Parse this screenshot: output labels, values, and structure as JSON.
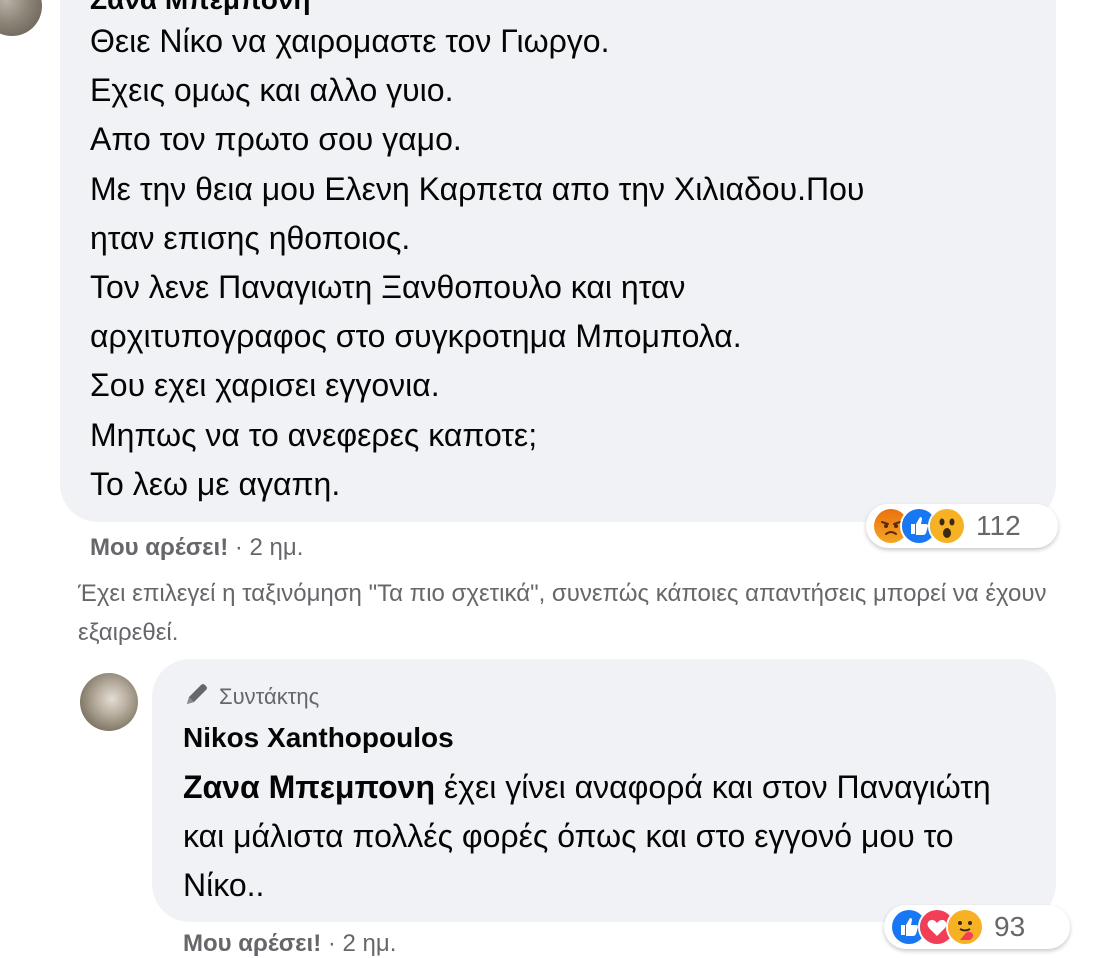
{
  "top_comment": {
    "author": "Ζανα Μπεμπονη",
    "lines": [
      "Θειε Νίκο να χαιρομαστε τον Γιωργο.",
      "Εχεις ομως και αλλο γυιο.",
      "Απο τον πρωτο σου γαμο.",
      "Με την θεια μου Ελενη Καρπετα απο την Χιλιαδου.Που",
      "ηταν επισης ηθοποιος.",
      "Τον λενε Παναγιωτη Ξανθοπουλο και ηταν",
      "αρχιτυπογραφος στο συγκροτημα Μπομπολα.",
      "Σου εχει χαρισει εγγονια.",
      "Μηπως να το ανεφερες καποτε;",
      "Το λεω με αγαπη."
    ],
    "reactions": {
      "icons": [
        "angry-icon",
        "like-icon",
        "wow-icon"
      ],
      "count": "112"
    },
    "like_label": "Μου αρέσει!",
    "time": "· 2 ημ."
  },
  "sort_note": "Έχει επιλεγεί η ταξινόμηση \"Τα πιο σχετικά\", συνεπώς κάποιες απαντήσεις μπορεί να έχουν εξαιρεθεί.",
  "reply": {
    "badge": "Συντάκτης",
    "author": "Nikos Xanthopoulos",
    "mention": "Ζανα Μπεμπονη",
    "text": " έχει γίνει αναφορά και στον Παναγιώτη και μάλιστα πολλές φορές όπως και στο εγγονό μου το Νίκο..",
    "reactions": {
      "icons": [
        "like-icon",
        "love-icon",
        "care-icon"
      ],
      "count": "93"
    },
    "like_label": "Μου αρέσει!",
    "time": "· 2 ημ."
  },
  "colors": {
    "bubble": "#f0f2f5",
    "secondary_text": "#65676b",
    "like_blue": "#1877f2",
    "love_red": "#f33e58",
    "angry_orange": "#e9710f",
    "wow_yellow": "#f7b125"
  }
}
